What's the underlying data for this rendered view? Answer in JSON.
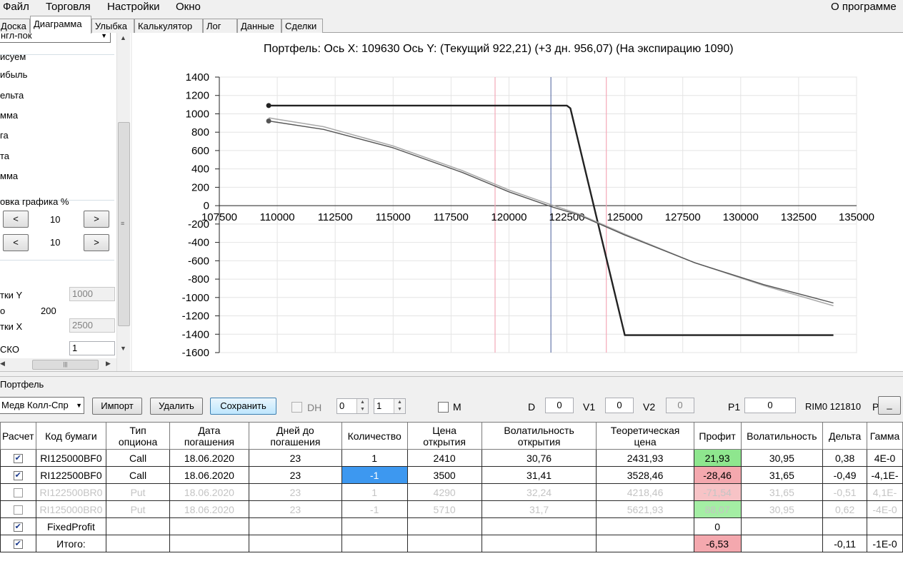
{
  "menu": {
    "items": [
      "Файл",
      "Торговля",
      "Настройки",
      "Окно"
    ],
    "about": "О программе"
  },
  "tabs": [
    "Доска",
    "Диаграмма",
    "Улыбка",
    "Калькулятор",
    "Лог",
    "Данные",
    "Сделки"
  ],
  "active_tab": "Диаграмма",
  "left_panel": {
    "combo_value": "нгл-пок",
    "group_title": "исуем",
    "draw_options": [
      "ибыль",
      "ельта",
      "мма",
      "га",
      "та",
      "мма"
    ],
    "shift_title": "овка графика %",
    "shift_rows": [
      {
        "left": "<",
        "value": "10",
        "right": ">"
      },
      {
        "left": "<",
        "value": "10",
        "right": ">"
      }
    ],
    "grid_y_label": "тки Y",
    "grid_y_value": "1000",
    "step_label": "о",
    "step_value": "200",
    "grid_x_label": "тки X",
    "grid_x_value": "2500",
    "sko_label": "СКО",
    "sko_value": "1"
  },
  "chart_data": {
    "type": "line",
    "title": "Портфель: Ось X: 109630 Ось Y:  (Текущий 922,21)  (+3 дн. 956,07)  (На экспирацию 1090)",
    "xlabel": "",
    "ylabel": "",
    "xlim": [
      107500,
      135000
    ],
    "ylim": [
      -1600,
      1400
    ],
    "x_ticks": [
      107500,
      110000,
      112500,
      115000,
      117500,
      120000,
      122500,
      125000,
      127500,
      130000,
      132500,
      135000
    ],
    "y_ticks": [
      1400,
      1200,
      1000,
      800,
      600,
      400,
      200,
      0,
      -200,
      -400,
      -600,
      -800,
      -1000,
      -1200,
      -1400,
      -1600
    ],
    "grid": true,
    "vertical_markers": [
      {
        "x": 119400,
        "color": "#f4a8b8"
      },
      {
        "x": 121810,
        "color": "#6677aa"
      },
      {
        "x": 124200,
        "color": "#f4a8b8"
      }
    ],
    "series": [
      {
        "color": "#222222",
        "width": 2.4,
        "marker_start": true,
        "x": [
          109630,
          122500,
          122650,
          125000,
          134000
        ],
        "y": [
          1090,
          1090,
          1060,
          -1410,
          -1410
        ]
      },
      {
        "color": "#aaaaaa",
        "width": 1.6,
        "marker_start": false,
        "x": [
          109630,
          112000,
          115000,
          118000,
          120000,
          121810,
          123000,
          125000,
          128000,
          131000,
          134000
        ],
        "y": [
          956,
          860,
          650,
          380,
          170,
          10,
          -90,
          -310,
          -620,
          -870,
          -1090
        ]
      },
      {
        "color": "#555555",
        "width": 1.4,
        "marker_start": true,
        "x": [
          109630,
          112000,
          115000,
          118000,
          120000,
          121810,
          123000,
          125000,
          128000,
          131000,
          134000
        ],
        "y": [
          922,
          830,
          630,
          360,
          150,
          -10,
          -100,
          -320,
          -620,
          -860,
          -1060
        ]
      }
    ]
  },
  "toolbar": {
    "portfolio_label": "Портфель",
    "strategy_combo": "Медв Колл-Спр",
    "import_label": "Импорт",
    "delete_label": "Удалить",
    "save_label": "Сохранить",
    "dh_label": "DH",
    "spin1": "0",
    "spin2": "1",
    "m_label": "M",
    "d_label": "D",
    "d_value": "0",
    "v1_label": "V1",
    "v1_value": "0",
    "v2_label": "V2",
    "v2_value": "0",
    "p1_label": "P1",
    "p1_value": "0",
    "underlying": "RIM0 121810",
    "p_label": "P",
    "small_btn": "_"
  },
  "table": {
    "headers": [
      "Расчет",
      "Код бумаги",
      "Тип\nопциона",
      "Дата\nпогашения",
      "Дней до\nпогашения",
      "Количество",
      "Цена\nоткрытия",
      "Волатильность\nоткрытия",
      "Теоретическая\nцена",
      "Профит",
      "Волатильность",
      "Дельта",
      "Гамма"
    ],
    "rows": [
      {
        "checked": true,
        "disabled": false,
        "cells": [
          "RI125000BF0",
          "Call",
          "18.06.2020",
          "23",
          "1",
          "2410",
          "30,76",
          "2431,93",
          "21,93",
          "30,95",
          "0,38",
          "4E-0"
        ],
        "profit_class": "pos",
        "qty_selected": false
      },
      {
        "checked": true,
        "disabled": false,
        "cells": [
          "RI122500BF0",
          "Call",
          "18.06.2020",
          "23",
          "-1",
          "3500",
          "31,41",
          "3528,46",
          "-28,46",
          "31,65",
          "-0,49",
          "-4,1E-"
        ],
        "profit_class": "neg",
        "qty_selected": true
      },
      {
        "checked": false,
        "disabled": true,
        "cells": [
          "RI122500BR0",
          "Put",
          "18.06.2020",
          "23",
          "1",
          "4290",
          "32,24",
          "4218,46",
          "-71,54",
          "31,65",
          "-0,51",
          "4,1E-"
        ],
        "profit_class": "neg",
        "qty_selected": false
      },
      {
        "checked": false,
        "disabled": true,
        "cells": [
          "RI125000BR0",
          "Put",
          "18.06.2020",
          "23",
          "-1",
          "5710",
          "31,7",
          "5621,93",
          "88,07",
          "30,95",
          "0,62",
          "-4E-0"
        ],
        "profit_class": "pos",
        "qty_selected": false
      },
      {
        "checked": true,
        "disabled": false,
        "cells": [
          "FixedProfit",
          "",
          "",
          "",
          "",
          "",
          "",
          "",
          "0",
          "",
          "",
          ""
        ],
        "profit_class": "",
        "qty_selected": false
      },
      {
        "checked": true,
        "disabled": false,
        "cells": [
          "Итого:",
          "",
          "",
          "",
          "",
          "",
          "",
          "",
          "-6,53",
          "",
          "-0,11",
          "-1E-0"
        ],
        "profit_class": "neg",
        "qty_selected": false
      }
    ]
  }
}
